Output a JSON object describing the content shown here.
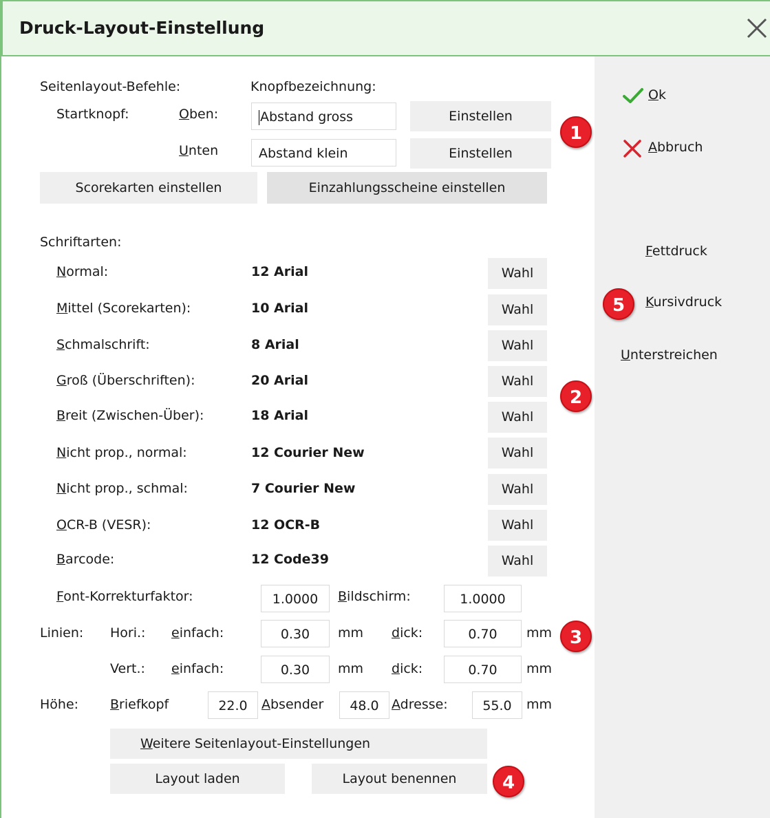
{
  "title": "Druck-Layout-Einstellung",
  "side": {
    "ok": "Ok",
    "cancel": "Abbruch",
    "bold": "Fettdruck",
    "italic": "Kursivdruck",
    "underline": "Unterstreichen"
  },
  "page_layout": {
    "heading": "Seitenlayout-Befehle:",
    "button_caption_heading": "Knopfbezeichnung:",
    "start_button": "Startknopf:",
    "top": {
      "label": "Oben:",
      "value": "Abstand gross",
      "button": "Einstellen"
    },
    "bottom": {
      "label": "Unten",
      "value": "Abstand klein",
      "button": "Einstellen"
    },
    "scorecards_button": "Scorekarten einstellen",
    "payment_slips_button": "Einzahlungsscheine einstellen"
  },
  "fonts": {
    "heading": "Schriftarten:",
    "choose": "Wahl",
    "items": [
      {
        "label": "Normal:",
        "value": "12 Arial"
      },
      {
        "label": "Mittel (Scorekarten):",
        "value": "10 Arial"
      },
      {
        "label": "Schmalschrift:",
        "value": "8 Arial"
      },
      {
        "label": "Groß (Überschriften):",
        "value": "20 Arial"
      },
      {
        "label": "Breit (Zwischen-Über):",
        "value": "18 Arial"
      },
      {
        "label": "Nicht prop., normal:",
        "value": "12 Courier New"
      },
      {
        "label": "Nicht prop., schmal:",
        "value": "7 Courier New"
      },
      {
        "label": "OCR-B (VESR):",
        "value": "12 OCR-B"
      },
      {
        "label": "Barcode:",
        "value": "12 Code39"
      }
    ]
  },
  "correction": {
    "label": "Font-Korrekturfaktor:",
    "value": "1.0000",
    "screen_label": "Bildschirm:",
    "screen_value": "1.0000"
  },
  "lines": {
    "label": "Linien:",
    "hori": {
      "label": "Hori.:",
      "simple_label": "einfach:",
      "simple": "0.30",
      "thick_label": "dick:",
      "thick": "0.70"
    },
    "vert": {
      "label": "Vert.:",
      "simple_label": "einfach:",
      "simple": "0.30",
      "thick_label": "dick:",
      "thick": "0.70"
    },
    "unit": "mm"
  },
  "height": {
    "label": "Höhe:",
    "letterhead_label": "Briefkopf",
    "letterhead": "22.0",
    "sender_label": "Absender",
    "sender": "48.0",
    "address_label": "Adresse:",
    "address": "55.0",
    "unit": "mm"
  },
  "bottom_buttons": {
    "more": "Weitere Seitenlayout-Einstellungen",
    "load": "Layout laden",
    "rename": "Layout benennen"
  },
  "badges": [
    "1",
    "2",
    "3",
    "4",
    "5"
  ],
  "colors": {
    "title_bg": "#eaf7e9",
    "title_border": "#7cc47c",
    "badge": "#e8202a",
    "ok_check": "#3aaa35",
    "cancel_x": "#d9232e"
  }
}
